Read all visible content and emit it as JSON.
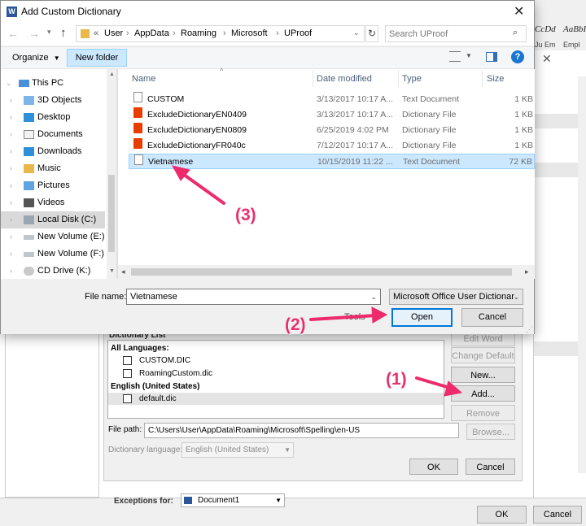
{
  "word_background": {
    "styles_gallery": [
      "CcDd",
      "AaBbI"
    ],
    "styles_gallery_sub": [
      "Ju Em",
      "Empl"
    ],
    "ok_label": "OK",
    "cancel_label": "Cancel"
  },
  "custom_dict_panel": {
    "list_header": "Dictionary List",
    "edit_word_list": "Edit Word List...",
    "change_default": "Change Default",
    "new": "New...",
    "add": "Add...",
    "remove": "Remove",
    "browse": "Browse...",
    "group_all": "All Languages:",
    "items_all": [
      "CUSTOM.DIC",
      "RoamingCustom.dic"
    ],
    "group_en": "English (United States)",
    "items_en": [
      "default.dic"
    ],
    "file_path_label": "File path:",
    "file_path_value": "C:\\Users\\User\\AppData\\Roaming\\Microsoft\\Spelling\\en-US",
    "dict_language_label": "Dictionary language:",
    "dict_language_value": "English (United States)",
    "ok": "OK",
    "cancel": "Cancel",
    "exceptions_label": "Exceptions for:",
    "exceptions_value": "Document1"
  },
  "dialog": {
    "title": "Add Custom Dictionary",
    "breadcrumb": [
      "User",
      "AppData",
      "Roaming",
      "Microsoft",
      "UProof"
    ],
    "breadcrumb_prefix": "«",
    "search_placeholder": "Search UProof",
    "organize": "Organize",
    "new_folder": "New folder",
    "nav_items": [
      {
        "label": "This PC",
        "icon": "pc-icon"
      },
      {
        "label": "3D Objects",
        "icon": "3d-objects-icon"
      },
      {
        "label": "Desktop",
        "icon": "desktop-icon"
      },
      {
        "label": "Documents",
        "icon": "documents-icon"
      },
      {
        "label": "Downloads",
        "icon": "downloads-icon"
      },
      {
        "label": "Music",
        "icon": "music-icon"
      },
      {
        "label": "Pictures",
        "icon": "pictures-icon"
      },
      {
        "label": "Videos",
        "icon": "videos-icon"
      },
      {
        "label": "Local Disk (C:)",
        "icon": "local-disk-icon"
      },
      {
        "label": "New Volume (E:)",
        "icon": "drive-icon"
      },
      {
        "label": "New Volume (F:)",
        "icon": "drive-icon"
      },
      {
        "label": "CD Drive (K:)",
        "icon": "cd-drive-icon"
      }
    ],
    "columns": {
      "name": "Name",
      "date": "Date modified",
      "type": "Type",
      "size": "Size"
    },
    "files": [
      {
        "name": "CUSTOM",
        "date": "3/13/2017 10:17 A...",
        "type": "Text Document",
        "size": "1 KB",
        "icon": "text-document-icon"
      },
      {
        "name": "ExcludeDictionaryEN0409",
        "date": "3/13/2017 10:17 A...",
        "type": "Dictionary File",
        "size": "1 KB",
        "icon": "office-dictionary-icon"
      },
      {
        "name": "ExcludeDictionaryEN0809",
        "date": "6/25/2019 4:02 PM",
        "type": "Dictionary File",
        "size": "1 KB",
        "icon": "office-dictionary-icon"
      },
      {
        "name": "ExcludeDictionaryFR040c",
        "date": "7/12/2017 10:17 A...",
        "type": "Dictionary File",
        "size": "1 KB",
        "icon": "office-dictionary-icon"
      },
      {
        "name": "Vietnamese",
        "date": "10/15/2019 11:22 ...",
        "type": "Text Document",
        "size": "72 KB",
        "icon": "text-document-icon"
      }
    ],
    "selected_file": "Vietnamese",
    "file_name_label": "File name:",
    "file_name_value": "Vietnamese",
    "file_type_value": "Microsoft Office User Dictionar",
    "tools": "Tools",
    "open": "Open",
    "cancel": "Cancel"
  },
  "annotations": {
    "step1": "(1)",
    "step2": "(2)",
    "step3": "(3)",
    "color": "#ec2a6c"
  }
}
